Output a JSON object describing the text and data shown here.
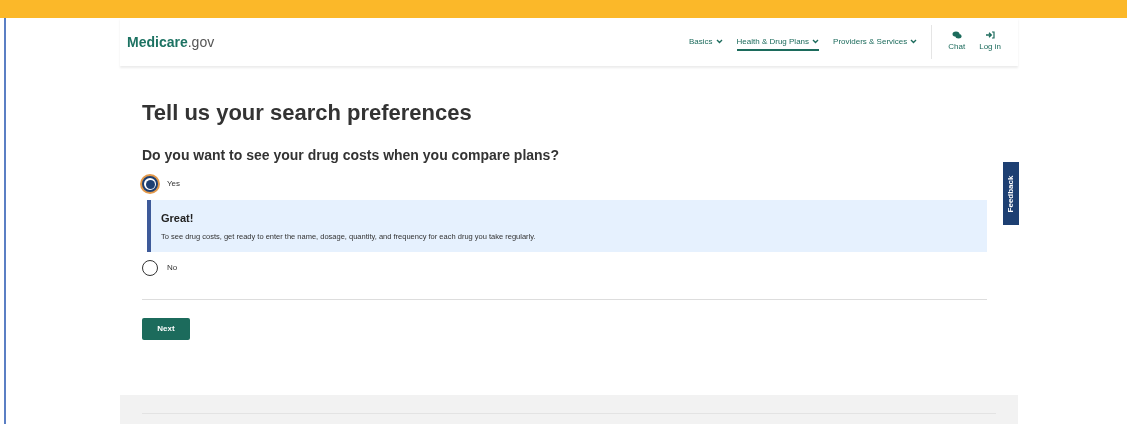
{
  "header": {
    "logo": "**Medicare**.gov",
    "nav": [
      {
        "label": "Basics",
        "selected": false
      },
      {
        "label": "Health & Drug Plans",
        "selected": true
      },
      {
        "label": "Providers & Services",
        "selected": false
      }
    ],
    "actions": [
      {
        "kind": "chat",
        "label": "Chat"
      },
      {
        "kind": "login",
        "label": "Log in"
      }
    ]
  },
  "title": "Tell us your search preferences",
  "question": "Do you want to see your drug costs when you compare plans?",
  "options": [
    {
      "label": "Yes",
      "selected": true,
      "alert": {
        "title": "Great!",
        "text": "To see drug costs, get ready to enter the name, dosage, quantity, and frequency for each drug you take regularly."
      }
    },
    {
      "label": "No",
      "selected": false
    }
  ],
  "next_button": "Next",
  "feedback_tab": "Feedback"
}
